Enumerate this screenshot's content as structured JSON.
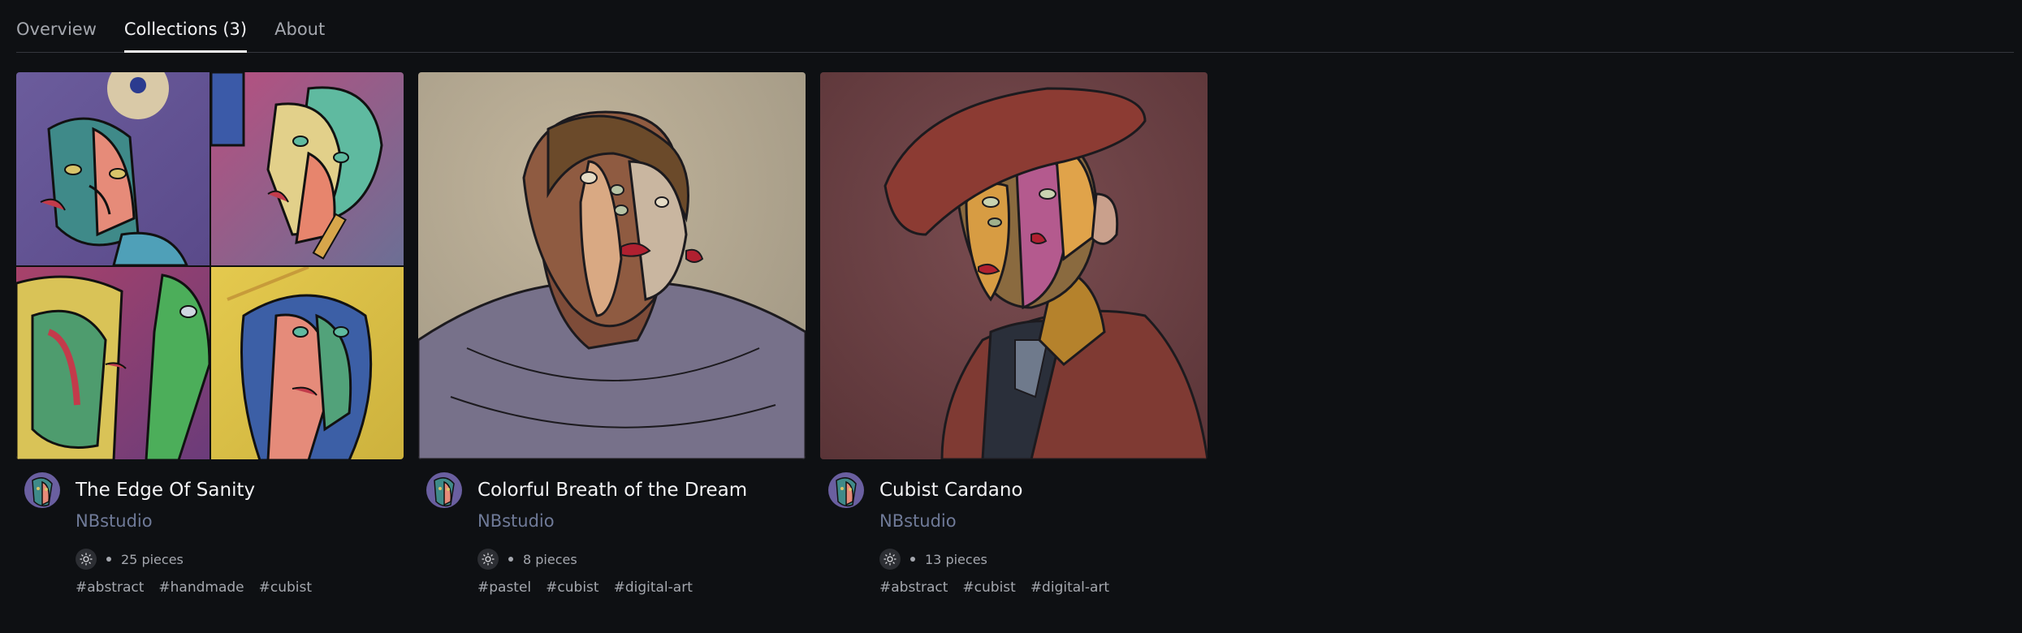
{
  "tabs": [
    {
      "label": "Overview",
      "active": false
    },
    {
      "label": "Collections (3)",
      "active": true
    },
    {
      "label": "About",
      "active": false
    }
  ],
  "collections": [
    {
      "title": "The Edge Of Sanity",
      "author": "NBstudio",
      "pieces": "25 pieces",
      "tags": [
        "#abstract",
        "#handmade",
        "#cubist"
      ],
      "palette": [
        "#6a5fa0",
        "#c94f5a",
        "#3b9a8f",
        "#e6c545"
      ]
    },
    {
      "title": "Colorful Breath of the Dream",
      "author": "NBstudio",
      "pieces": "8 pieces",
      "tags": [
        "#pastel",
        "#cubist",
        "#digital-art"
      ],
      "palette": [
        "#b7ab93",
        "#7b4d3a",
        "#756f86",
        "#c9b48c"
      ]
    },
    {
      "title": "Cubist Cardano",
      "author": "NBstudio",
      "pieces": "13 pieces",
      "tags": [
        "#abstract",
        "#cubist",
        "#digital-art"
      ],
      "palette": [
        "#6a3f45",
        "#8c3d35",
        "#d9a14a",
        "#b04f8e"
      ]
    }
  ],
  "icons": {
    "network": "sun-network-icon"
  }
}
